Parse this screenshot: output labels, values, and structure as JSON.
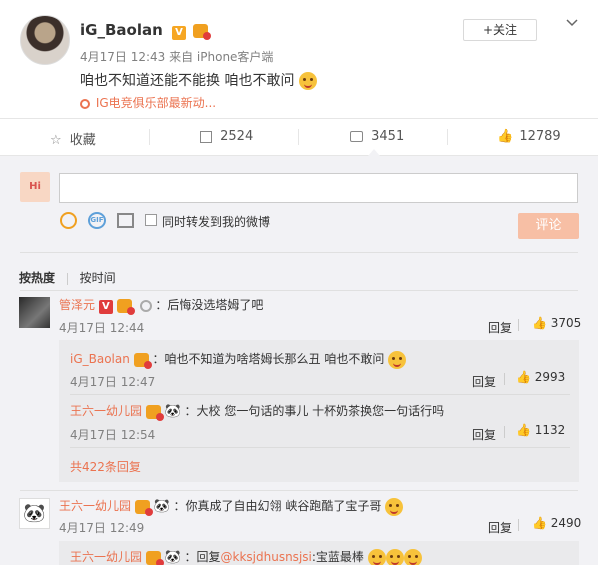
{
  "post": {
    "author": "iG_Baolan",
    "meta": "4月17日 12:43 来自 iPhone客户端",
    "text": "咱也不知道还能不能换 咱也不敢问",
    "source": "IG电竞俱乐部最新动...",
    "follow_label": "+关注",
    "colors": {
      "accent": "#eb7350",
      "link": "#eb7350",
      "badge": "#f6a623"
    }
  },
  "actions": {
    "favorite": "收藏",
    "repost": "2524",
    "comment": "3451",
    "like": "12789"
  },
  "composer": {
    "repost_label": "同时转发到我的微博",
    "submit_label": "评论",
    "avatar_text": "Hi"
  },
  "sort": {
    "hot": "按热度",
    "time": "按时间"
  },
  "comments": [
    {
      "name": "管泽元",
      "text": "：后悔没选塔姆了吧",
      "time": "4月17日 12:44",
      "reply": "回复",
      "likes": "3705",
      "replies": [
        {
          "name": "iG_Baolan",
          "text": "：咱也不知道为啥塔姆长那么丑 咱也不敢问",
          "time": "4月17日 12:47",
          "reply": "回复",
          "likes": "2993"
        },
        {
          "name": "王六一幼儿园",
          "text": "：大校 您一句话的事儿 十杯奶茶换您一句话行吗",
          "time": "4月17日 12:54",
          "reply": "回复",
          "likes": "1132"
        }
      ],
      "more": "共422条回复"
    },
    {
      "name": "王六一幼儿园",
      "text": "：你真成了自由幻翎 峡谷跑酷了宝子哥",
      "time": "4月17日 12:49",
      "reply": "回复",
      "likes": "2490",
      "replies": [
        {
          "name": "王六一幼儿园",
          "text_prefix": "：回复",
          "mention": "@kksjdhusnsjsi",
          "text": ":宝蓝最棒"
        }
      ]
    }
  ]
}
